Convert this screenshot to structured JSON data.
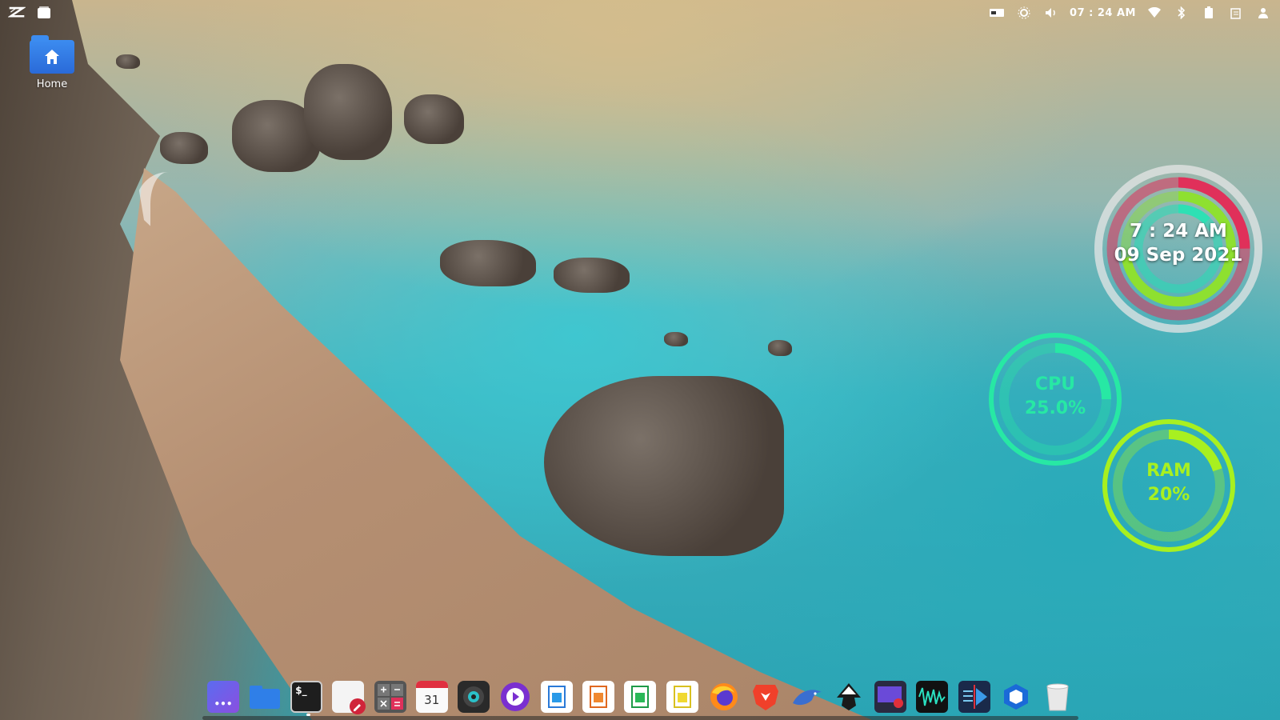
{
  "topbar": {
    "clock": "07 : 24 AM"
  },
  "desktop": {
    "home_label": "Home"
  },
  "widgets": {
    "clock_time": "7 : 24 AM",
    "clock_date": "09 Sep 2021",
    "cpu_label": "CPU",
    "cpu_value": "25.0%",
    "cpu_fraction": 0.25,
    "ram_label": "RAM",
    "ram_value": "20%",
    "ram_fraction": 0.2
  },
  "dock": {
    "apps": [
      {
        "name": "app-launcher",
        "icon": "app-grid-icon"
      },
      {
        "name": "file-manager",
        "icon": "folder-icon"
      },
      {
        "name": "terminal",
        "icon": "terminal-icon",
        "text": "$_"
      },
      {
        "name": "text-editor",
        "icon": "text-editor-icon"
      },
      {
        "name": "calculator",
        "icon": "calculator-icon"
      },
      {
        "name": "calendar",
        "icon": "calendar-icon",
        "text": "31"
      },
      {
        "name": "disk-utility",
        "icon": "disk-icon"
      },
      {
        "name": "media-player",
        "icon": "media-player-icon"
      },
      {
        "name": "office-writer",
        "icon": "document-icon"
      },
      {
        "name": "office-presentation",
        "icon": "presentation-icon"
      },
      {
        "name": "office-spreadsheet",
        "icon": "spreadsheet-icon"
      },
      {
        "name": "office-notes",
        "icon": "notes-icon"
      },
      {
        "name": "firefox",
        "icon": "firefox-icon"
      },
      {
        "name": "brave",
        "icon": "brave-icon"
      },
      {
        "name": "kdenlive",
        "icon": "dolphin-icon"
      },
      {
        "name": "inkscape",
        "icon": "inkscape-icon"
      },
      {
        "name": "screen-recorder",
        "icon": "screen-recorder-icon"
      },
      {
        "name": "audio-editor",
        "icon": "waveform-icon"
      },
      {
        "name": "video-editor",
        "icon": "video-editor-icon"
      },
      {
        "name": "virtualbox",
        "icon": "virtualbox-icon"
      },
      {
        "name": "trash",
        "icon": "trash-icon"
      }
    ]
  },
  "colors": {
    "cpu_ring": "#27e8a4",
    "ram_ring": "#a8f020",
    "clock_ring_outer": "#e0305a",
    "clock_ring_inner": "#8ee030"
  }
}
